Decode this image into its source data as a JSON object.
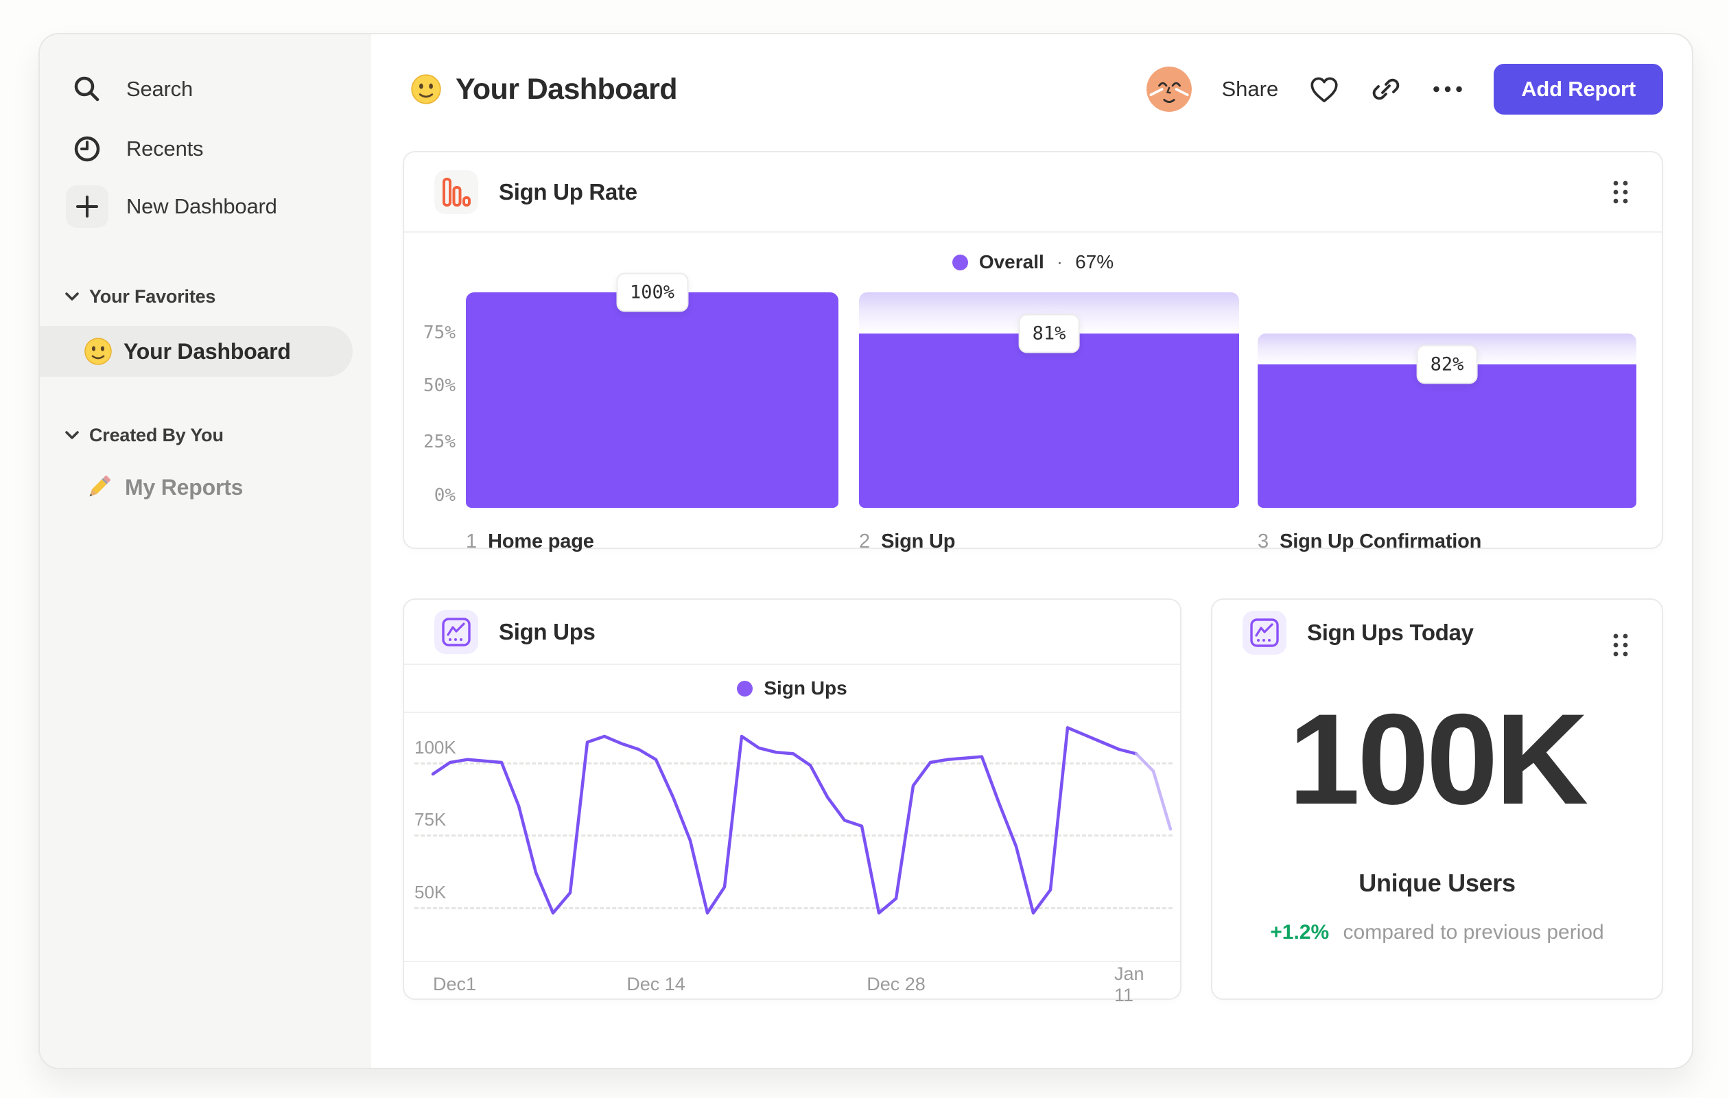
{
  "app": {
    "sidebar": {
      "items": [
        {
          "label": "Search",
          "icon": "search-icon"
        },
        {
          "label": "Recents",
          "icon": "clock-icon"
        },
        {
          "label": "New Dashboard",
          "icon": "plus-icon"
        }
      ],
      "sections": [
        {
          "label": "Your Favorites",
          "items": [
            {
              "label": "Your Dashboard",
              "icon": "smiley-icon",
              "selected": true
            }
          ]
        },
        {
          "label": "Created By You",
          "items": [
            {
              "label": "My Reports",
              "icon": "pencil-icon",
              "selected": false
            }
          ]
        }
      ]
    },
    "header": {
      "title": "Your Dashboard",
      "title_icon": "smiley-icon",
      "share_label": "Share",
      "add_report_label": "Add Report"
    }
  },
  "chart_data": [
    {
      "id": "sign-up-rate",
      "type": "bar",
      "subtype": "funnel",
      "title": "Sign Up Rate",
      "legend": {
        "label": "Overall",
        "separator": "·",
        "value": "67%",
        "position": "top center"
      },
      "yticks": [
        "75%",
        "50%",
        "25%",
        "0%"
      ],
      "ylim": [
        0,
        100
      ],
      "grid": false,
      "color": "#8052f8",
      "steps": [
        {
          "index": "1",
          "label": "Home page",
          "rate_pct": 100,
          "rate_label": "100%"
        },
        {
          "index": "2",
          "label": "Sign Up",
          "rate_pct": 81,
          "rate_label": "81%"
        },
        {
          "index": "3",
          "label": "Sign Up Confirmation",
          "rate_pct": 82,
          "rate_label": "82%"
        }
      ],
      "overall_conversion_pct": 67
    },
    {
      "id": "sign-ups",
      "type": "line",
      "title": "Sign Ups",
      "legend": {
        "label": "Sign Ups",
        "position": "top center"
      },
      "unit": "K",
      "yticks": [
        {
          "label": "100K",
          "value": 100
        },
        {
          "label": "75K",
          "value": 75
        },
        {
          "label": "50K",
          "value": 50
        }
      ],
      "ylim": [
        40,
        118
      ],
      "grid": "dashed-horizontal",
      "color": "#7b52f3",
      "faded_tail_color": "#c0abf8",
      "x_labels": [
        {
          "label": "Dec1",
          "day": 0
        },
        {
          "label": "Dec 14",
          "day": 13
        },
        {
          "label": "Dec 28",
          "day": 27
        },
        {
          "label": "Jan 11",
          "day": 41
        }
      ],
      "values": [
        96,
        100,
        101,
        100.5,
        100,
        85,
        62,
        48,
        55,
        107,
        109,
        106.5,
        104.5,
        101,
        88,
        73,
        48,
        57,
        109,
        105,
        103.5,
        103,
        99,
        88,
        80,
        78,
        48,
        53,
        92,
        100,
        101,
        101.5,
        102,
        86,
        71,
        48,
        56,
        112,
        109.5,
        107,
        104.5,
        103,
        97,
        77
      ],
      "faded_from_index": 41
    }
  ],
  "metric_card": {
    "title": "Sign Ups Today",
    "value": "100K",
    "label": "Unique Users",
    "delta": "+1.2%",
    "delta_note": "compared to previous period"
  },
  "colors": {
    "accent_bar_purple": "#8052f8",
    "line_purple": "#7b52f3",
    "button_purple": "#5b4fe9",
    "funnel_icon_orange": "#f2613e",
    "positive_green": "#0fa563",
    "sidebar_bg": "#f6f6f4",
    "legend_dot_purple": "#8a5af6"
  }
}
